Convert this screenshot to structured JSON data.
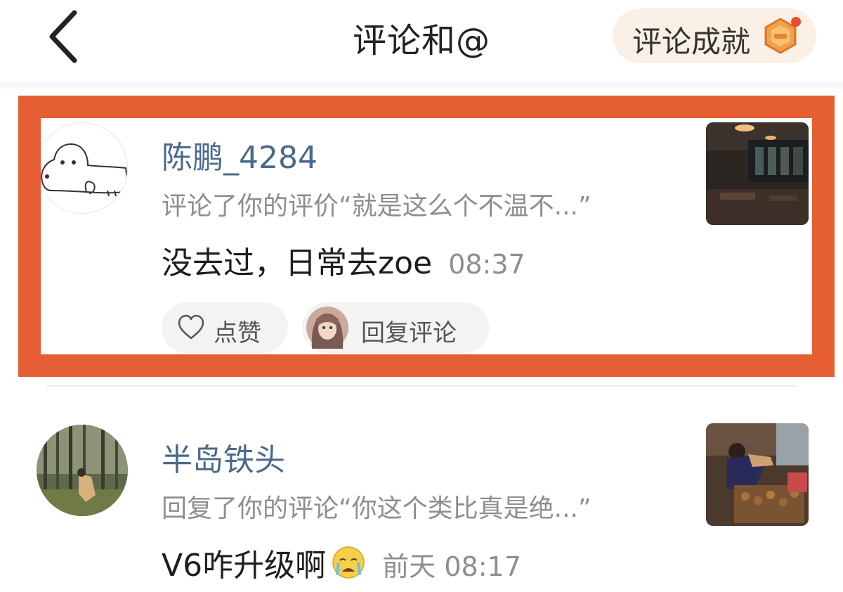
{
  "header": {
    "title": "评论和@",
    "achievement_label": "评论成就",
    "back_icon": "chevron-left-icon",
    "medal_icon": "achievement-medal-icon",
    "notification_dot_color": "#f04a2f"
  },
  "highlight_color": "#e65e33",
  "notifications": [
    {
      "username": "陈鹏_4284",
      "action": "评论了你的评价“就是这么个不温不...”",
      "content": "没去过，日常去zoe",
      "time": "08:37",
      "like_label": "点赞",
      "reply_label": "回复评论",
      "avatar": "doodle-dog-avatar",
      "thumbnail": "restaurant-interior-photo"
    },
    {
      "username": "半岛铁头",
      "action": "回复了你的评论“你这个类比真是绝...”",
      "content": "V6咋升级啊",
      "emoji": "crying-face-emoji",
      "time": "前天 08:17",
      "avatar": "forest-person-photo",
      "thumbnail": "market-vendor-photo"
    }
  ]
}
